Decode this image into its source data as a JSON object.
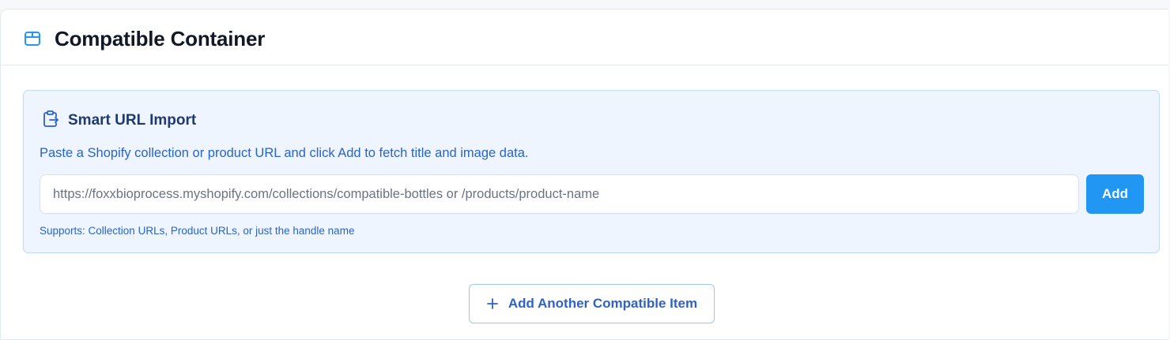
{
  "header": {
    "title": "Compatible Container",
    "icon": "package-icon"
  },
  "smart_import": {
    "title": "Smart URL Import",
    "icon": "clipboard-import-icon",
    "description": "Paste a Shopify collection or product URL and click Add to fetch title and image data.",
    "input": {
      "value": "",
      "placeholder": "https://foxxbioprocess.myshopify.com/collections/compatible-bottles or /products/product-name"
    },
    "add_label": "Add",
    "hint": "Supports: Collection URLs, Product URLs, or just the handle name"
  },
  "add_another": {
    "label": "Add Another Compatible Item",
    "icon": "plus-icon"
  },
  "colors": {
    "accent": "#2196f3",
    "panel_bg": "#eef5ff",
    "panel_border": "#bfd9f6",
    "link_text": "#2a63c9",
    "title_text": "#121826"
  }
}
